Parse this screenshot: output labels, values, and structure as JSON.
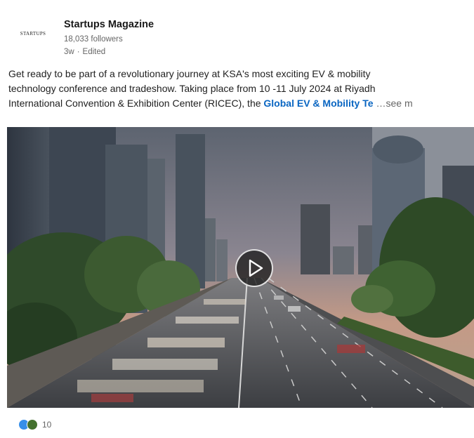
{
  "post": {
    "author": {
      "name": "Startups Magazine",
      "logo_text": "STARTUPS",
      "followers": "18,033 followers",
      "time": "3w",
      "separator": "·",
      "edited": "Edited"
    },
    "text": {
      "line1": "Get ready to be part of a revolutionary journey at KSA's most exciting EV & mobility",
      "line2": "technology conference and tradeshow. Taking place from 10 -11 July 2024 at Riyadh",
      "line3": "International Convention & Exhibition Center (RICEC), the ",
      "link": "Global EV & Mobility Te",
      "see_more": "…see m"
    },
    "media": {
      "type": "video",
      "play_icon": "play-icon"
    },
    "reactions": {
      "icons": [
        "like-icon",
        "celebrate-icon"
      ],
      "count": "10"
    }
  },
  "colors": {
    "link": "#0a66c2",
    "secondary_text": "#666666",
    "like": "#378fe9",
    "celebrate": "#44712e"
  }
}
